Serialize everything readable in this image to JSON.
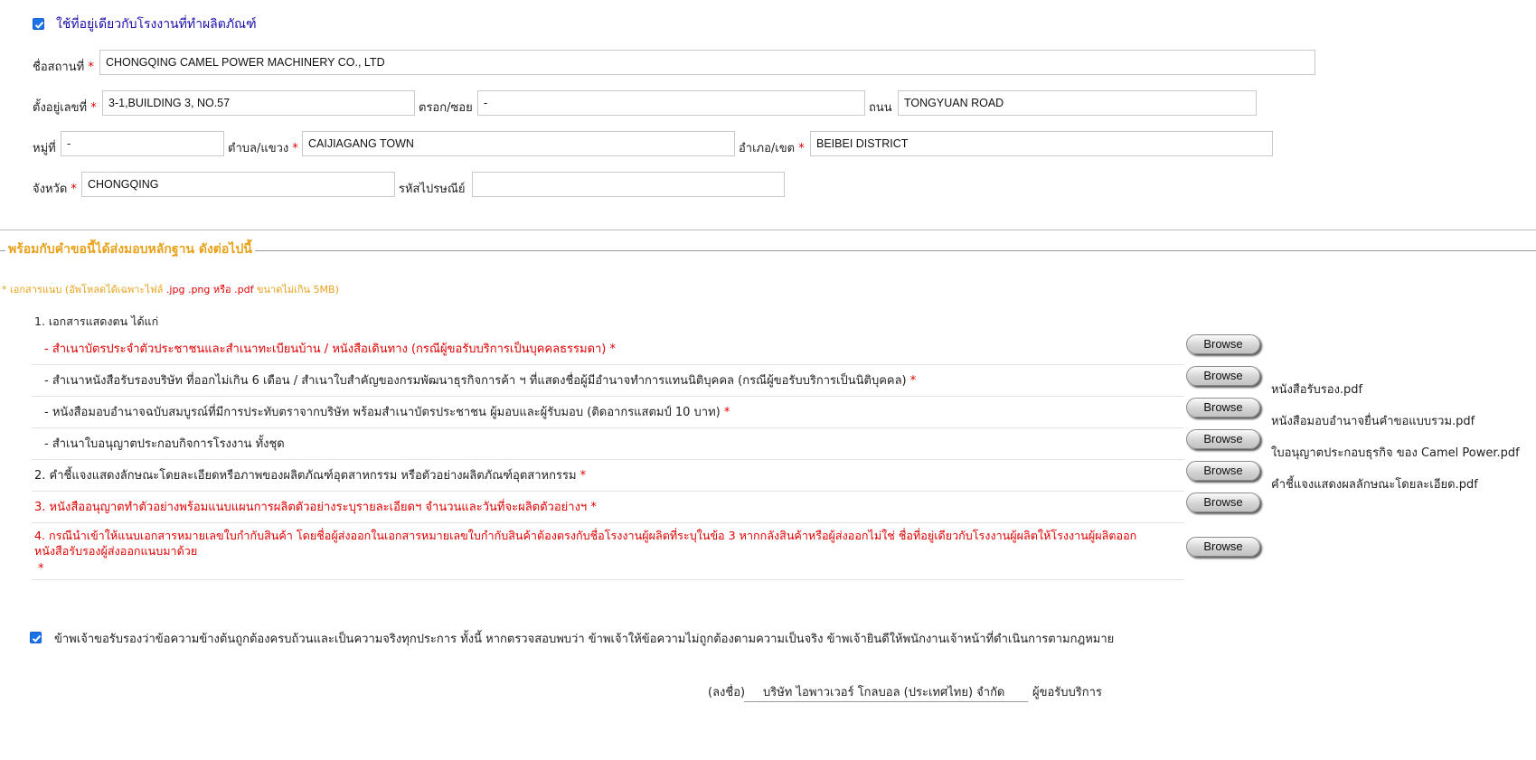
{
  "factory_same": {
    "checked": true,
    "label": "ใช้ที่อยู่เดียวกับโรงงานที่ทำผลิตภัณฑ์"
  },
  "address": {
    "place_label": "ชื่อสถานที่",
    "place_value": "CHONGQING CAMEL POWER MACHINERY CO., LTD",
    "number_label": "ตั้งอยู่เลขที่",
    "number_value": "3-1,BUILDING 3, NO.57",
    "alley_label": "ตรอก/ซอย",
    "alley_value": "-",
    "road_label": "ถนน",
    "road_value": "TONGYUAN ROAD",
    "moo_label": "หมู่ที่",
    "moo_value": "-",
    "subdistrict_label": "ตำบล/แขวง",
    "subdistrict_value": "CAIJIAGANG TOWN",
    "district_label": "อำเภอ/เขต",
    "district_value": "BEIBEI DISTRICT",
    "province_label": "จังหวัด",
    "province_value": "CHONGQING",
    "postcode_label": "รหัสไปรษณีย์",
    "postcode_value": "",
    "required_mark": "*"
  },
  "attachments": {
    "section_title": "พร้อมกับคำขอนี้ได้ส่งมอบหลักฐาน ดังต่อไปนี้",
    "note_prefix": "* เอกสารแนบ (อัพโหลดได้เฉพาะไฟล์",
    "note_ext": ".jpg .png หรือ .pdf",
    "note_suffix": "ขนาดไม่เกิน 5MB)",
    "group1_title": "1. เอกสารแสดงตน ได้แก่",
    "browse_label": "Browse",
    "items": [
      {
        "text": "- สำเนาบัตรประจำตัวประชาชนและสำเนาทะเบียนบ้าน / หนังสือเดินทาง (กรณีผู้ขอรับบริการเป็นบุคคลธรรมดา)",
        "req": "*",
        "file": ""
      },
      {
        "text": "- สำเนาหนังสือรับรองบริษัท ที่ออกไม่เกิน 6 เดือน / สำเนาใบสำคัญของกรมพัฒนาธุรกิจการค้า ฯ ที่แสดงชื่อผู้มีอำนาจทำการแทนนิติบุคคล (กรณีผู้ขอรับบริการเป็นนิติบุคคล)",
        "req": "*",
        "file": "หนังสือรับรอง.pdf"
      },
      {
        "text": "- หนังสือมอบอำนาจฉบับสมบูรณ์ที่มีการประทับตราจากบริษัท พร้อมสำเนาบัตรประชาชน ผู้มอบและผู้รับมอบ (ติดอากรแสตมป์ 10 บาท)",
        "req": "*",
        "file": "หนังสือมอบอำนาจยื่นคำขอแบบรวม.pdf"
      },
      {
        "text": "- สำเนาใบอนุญาตประกอบกิจการโรงงาน ทั้งชุด",
        "req": "",
        "file": "ใบอนุญาตประกอบธุรกิจ ของ Camel Power.pdf"
      },
      {
        "text": "2. คำชี้แจงแสดงลักษณะโดยละเอียดหรือภาพของผลิตภัณฑ์อุตสาหกรรม หรือตัวอย่างผลิตภัณฑ์อุตสาหกรรม",
        "req": "*",
        "file": "คำชี้แจงแสดงผลลักษณะโดยละเอียด.pdf"
      },
      {
        "text": "3. หนังสืออนุญาตทำตัวอย่างพร้อมแนบแผนการผลิตตัวอย่างระบุรายละเอียดฯ จำนวนและวันที่จะผลิตตัวอย่างฯ",
        "req": "*",
        "file": ""
      },
      {
        "text_line1": "4. กรณีนำเข้าให้แนบเอกสารหมายเลขใบกำกับสินค้า โดยชื่อผู้ส่งออกในเอกสารหมายเลขใบกำกับสินค้าต้องตรงกับชื่อโรงงานผู้ผลิตที่ระบุในข้อ 3 หากกลังสินค้าหรือผู้ส่งออกไม่ใช่ ชื่อที่อยู่เดียวกับโรงงานผู้ผลิตให้โรงงานผู้ผลิตออก",
        "text_line2": "หนังสือรับรองผู้ส่งออกแนบมาด้วย",
        "req": "*",
        "file": ""
      }
    ]
  },
  "certify": {
    "checked": true,
    "text": "ข้าพเจ้าขอรับรองว่าข้อความข้างต้นถูกต้องครบถ้วนและเป็นความจริงทุกประการ ทั้งนี้ หากตรวจสอบพบว่า ข้าพเจ้าให้ข้อความไม่ถูกต้องตามความเป็นจริง ข้าพเจ้ายินดีให้พนักงานเจ้าหน้าที่ดำเนินการตามกฎหมาย"
  },
  "signature": {
    "prefix": "(ลงชื่อ)",
    "name": "บริษัท ไอพาวเวอร์ โกลบอล (ประเทศไทย) จำกัด",
    "suffix": "ผู้ขอรับบริการ"
  },
  "colors": {
    "required": "#e00000",
    "section_title": "#e8a21c",
    "checkbox": "#1a73e8",
    "checkbox_label": "#1a0dab"
  }
}
